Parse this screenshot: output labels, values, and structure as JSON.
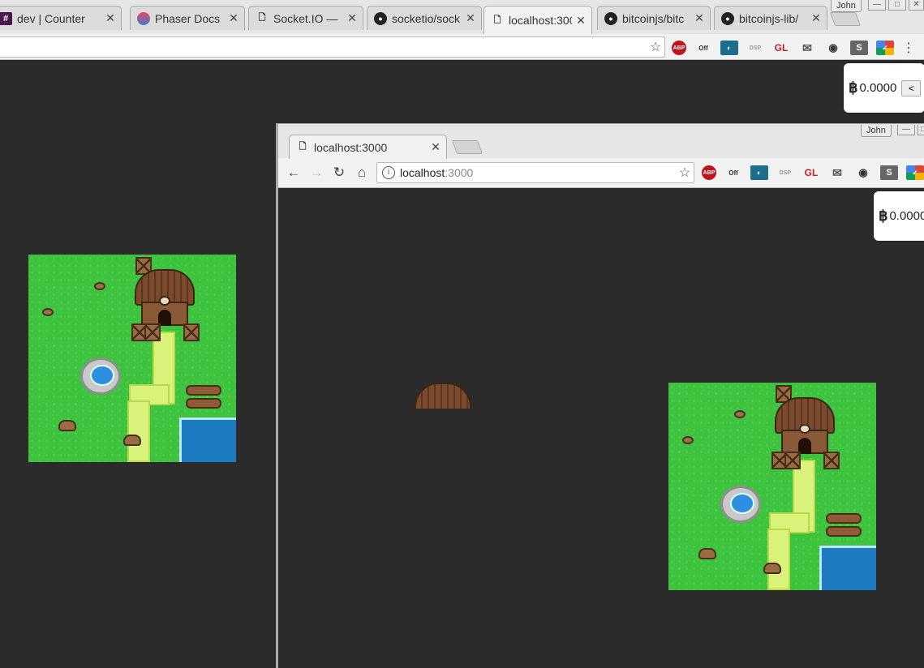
{
  "outer_browser": {
    "tabs": [
      {
        "title": "dev | Counter",
        "icon": "slack-hash-icon",
        "favicon_text": "#"
      },
      {
        "title": "Phaser Docs",
        "icon": "phaser-icon",
        "favicon_text": ""
      },
      {
        "title": "Socket.IO —",
        "icon": "page-icon",
        "favicon_text": ""
      },
      {
        "title": "socketio/sock",
        "icon": "github-icon",
        "favicon_text": ""
      },
      {
        "title": "localhost:300",
        "icon": "page-icon",
        "favicon_text": ""
      },
      {
        "title": "bitcoinjs/bitc",
        "icon": "github-icon",
        "favicon_text": ""
      },
      {
        "title": "bitcoinjs-lib/",
        "icon": "github-icon",
        "favicon_text": ""
      }
    ],
    "active_tab": 4,
    "profile_name": "John",
    "address_value": "",
    "extensions": {
      "abp": "ABP",
      "off": "Off",
      "dsp": "DSP",
      "gl": "GL",
      "s": "S"
    }
  },
  "inner_browser": {
    "tab_title": "localhost:3000",
    "profile_name": "John",
    "url_host": "localhost",
    "url_port": ":3000"
  },
  "balance": {
    "symbol": "฿",
    "amount": "0.0000",
    "toggle_label": "<"
  },
  "inner_balance": {
    "symbol": "฿",
    "amount": "0.0000"
  },
  "colors": {
    "page_background": "#2b2b2b",
    "grass": "#3ec33e",
    "water": "#1c7bc1",
    "path": "#d9f27a"
  }
}
